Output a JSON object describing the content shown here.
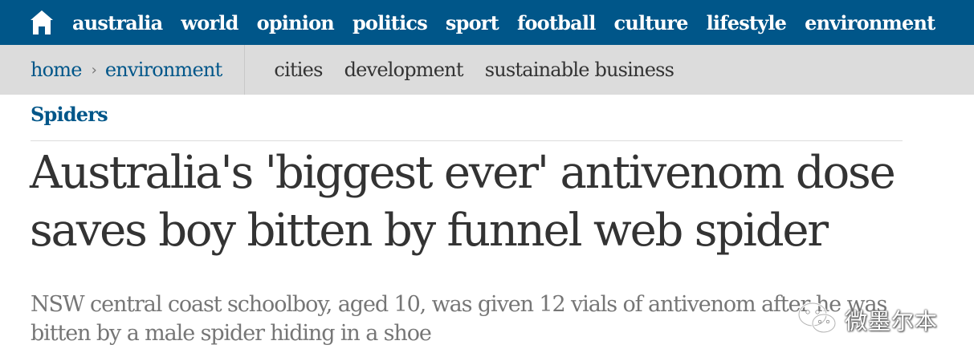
{
  "topnav": {
    "home_icon": "home-icon",
    "items": [
      "australia",
      "world",
      "opinion",
      "politics",
      "sport",
      "football",
      "culture",
      "lifestyle",
      "environment"
    ]
  },
  "subnav": {
    "breadcrumb": [
      "home",
      "environment"
    ],
    "separator": "›",
    "links": [
      "cities",
      "development",
      "sustainable business"
    ]
  },
  "article": {
    "section": "Spiders",
    "headline": "Australia's 'biggest ever' antivenom dose saves boy bitten by funnel web spider",
    "standfirst": "NSW central coast schoolboy, aged 10, was given 12 vials of antivenom after he was bitten by a male spider hiding in a shoe"
  },
  "watermark": {
    "icon": "wechat-icon",
    "text": "微墨尔本"
  },
  "colors": {
    "brand_blue": "#005689",
    "subnav_bg": "#dcdcdc",
    "headline": "#333333",
    "standfirst": "#767676"
  }
}
